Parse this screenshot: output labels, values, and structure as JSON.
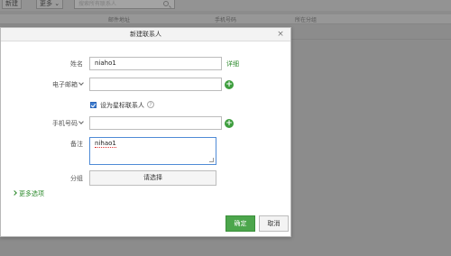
{
  "background": {
    "toolbar": {
      "new_label": "新建",
      "more_label": "更多",
      "search_placeholder": "搜索所有联系人"
    },
    "columns": [
      "邮件地址",
      "手机号码",
      "所在分组"
    ]
  },
  "dialog": {
    "title": "新建联系人",
    "close": "×",
    "name_label": "姓名",
    "name_value": "niaho1",
    "detail_link": "详细",
    "email_label": "电子邮箱",
    "email_value": "",
    "star_label": "设为星标联系人",
    "phone_label": "手机号码",
    "phone_value": "",
    "notes_label": "备注",
    "notes_value": "nihao1",
    "group_label": "分组",
    "group_button": "请选择",
    "more_options": "更多选项",
    "ok": "确定",
    "cancel": "取消"
  },
  "colors": {
    "accent_green": "#4ca64c",
    "checkbox_blue": "#3f7dd0"
  }
}
